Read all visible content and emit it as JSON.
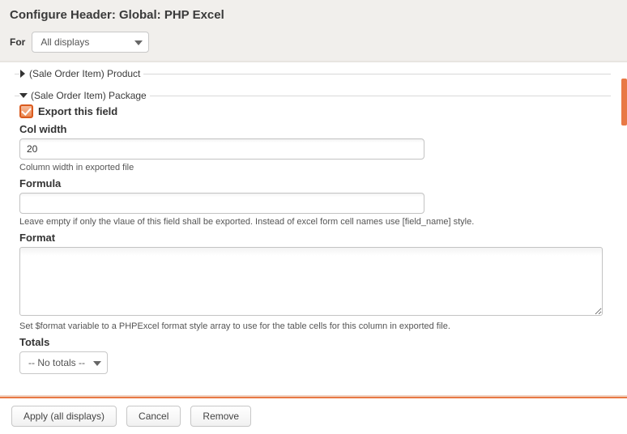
{
  "header": {
    "title": "Configure Header: Global: PHP Excel",
    "for_label": "For",
    "display_selected": "All displays"
  },
  "sections": {
    "product": {
      "legend": "(Sale Order Item) Product"
    },
    "package": {
      "legend": "(Sale Order Item) Package",
      "export_label": "Export this field",
      "export_checked": true,
      "col_width": {
        "label": "Col width",
        "value": "20",
        "help": "Column width in exported file"
      },
      "formula": {
        "label": "Formula",
        "value": "",
        "help": "Leave empty if only the vlaue of this field shall be exported. Instead of excel form cell names use [field_name] style."
      },
      "format": {
        "label": "Format",
        "value": "",
        "help": "Set $format variable to a PHPExcel format style array to use for the table cells for this column in exported file."
      },
      "totals": {
        "label": "Totals",
        "selected": "-- No totals --"
      }
    }
  },
  "footer": {
    "apply": "Apply (all displays)",
    "cancel": "Cancel",
    "remove": "Remove"
  }
}
